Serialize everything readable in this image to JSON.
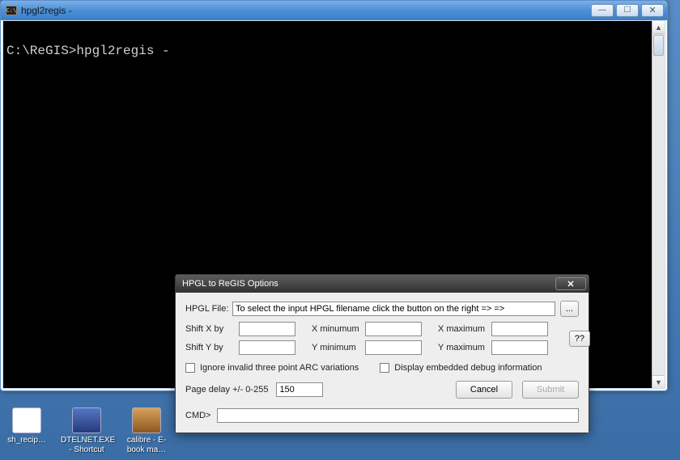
{
  "console": {
    "title": "hpgl2regis  -",
    "content": "C:\\ReGIS>hpgl2regis -"
  },
  "dialog": {
    "title": "HPGL to ReGIS Options",
    "hpgl_file_label": "HPGL File:",
    "hpgl_file_value": "To select the input HPGL filename click the button on the right => =>",
    "browse_label": "...",
    "shift_x_label": "Shift X by",
    "shift_y_label": "Shift Y by",
    "xmin_label": "X minumum",
    "xmax_label": "X maximum",
    "ymin_label": "Y minimum",
    "ymax_label": "Y maximum",
    "shift_x_value": "",
    "shift_y_value": "",
    "xmin_value": "",
    "xmax_value": "",
    "ymin_value": "",
    "ymax_value": "",
    "help_label": "??",
    "chk_arc_label": "Ignore invalid three point ARC variations",
    "chk_debug_label": "Display embedded debug information",
    "page_delay_label": "Page delay +/- 0-255",
    "page_delay_value": "150",
    "cancel_label": "Cancel",
    "submit_label": "Submit",
    "cmd_label": "CMD>",
    "cmd_value": ""
  },
  "desktop": {
    "icon1_label": "sh_recip…",
    "icon2_label": "DTELNET.EXE - Shortcut",
    "icon3_label": "calibre - E-book ma…"
  },
  "window_controls": {
    "minimize": "—",
    "maximize": "☐",
    "close": "✕"
  }
}
